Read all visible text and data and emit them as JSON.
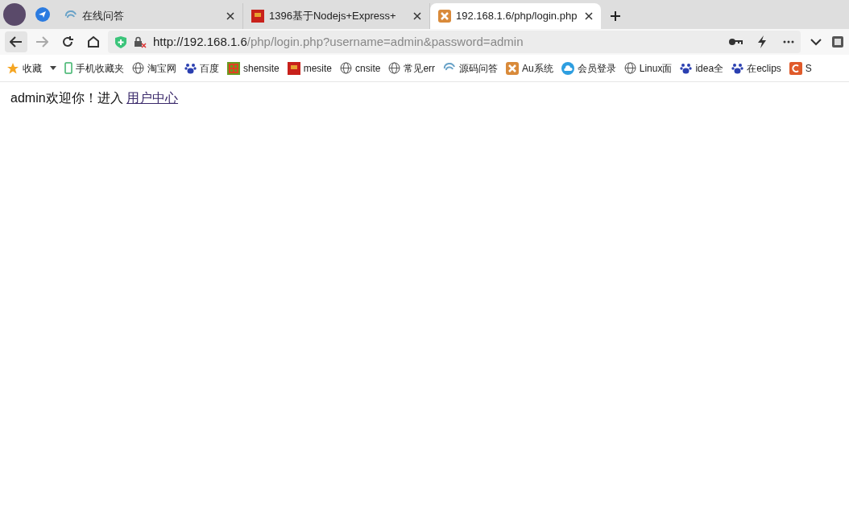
{
  "tabs": [
    {
      "title": "在线问答",
      "kind": "swirl",
      "selected": false
    },
    {
      "title": "1396基于Nodejs+Express+",
      "kind": "flag",
      "selected": false
    },
    {
      "title": "192.168.1.6/php/login.php",
      "kind": "xampp",
      "selected": true
    }
  ],
  "address_bar": {
    "host": "http://192.168.1.6",
    "path": "/php/login.php?username=admin&password=admin"
  },
  "bookmarks": [
    {
      "label": "收藏",
      "kind": "star",
      "dropdown": true
    },
    {
      "label": "手机收藏夹",
      "kind": "phone",
      "dropdown": false
    },
    {
      "label": "淘宝网",
      "kind": "globe",
      "dropdown": false
    },
    {
      "label": "百度",
      "kind": "paw",
      "dropdown": false
    },
    {
      "label": "shensite",
      "kind": "shen",
      "dropdown": false
    },
    {
      "label": "mesite",
      "kind": "flag",
      "dropdown": false
    },
    {
      "label": "cnsite",
      "kind": "globe",
      "dropdown": false
    },
    {
      "label": "常见err",
      "kind": "globe",
      "dropdown": false
    },
    {
      "label": "源码问答",
      "kind": "swirl",
      "dropdown": false
    },
    {
      "label": "Au系统",
      "kind": "xampp",
      "dropdown": false
    },
    {
      "label": "会员登录",
      "kind": "cloud",
      "dropdown": false
    },
    {
      "label": "Linux面",
      "kind": "globe",
      "dropdown": false
    },
    {
      "label": "idea全",
      "kind": "paw",
      "dropdown": false
    },
    {
      "label": "在eclips",
      "kind": "paw",
      "dropdown": false
    },
    {
      "label": "S",
      "kind": "c",
      "dropdown": false
    }
  ],
  "page": {
    "message": "admin欢迎你！进入",
    "link": "用户中心"
  }
}
